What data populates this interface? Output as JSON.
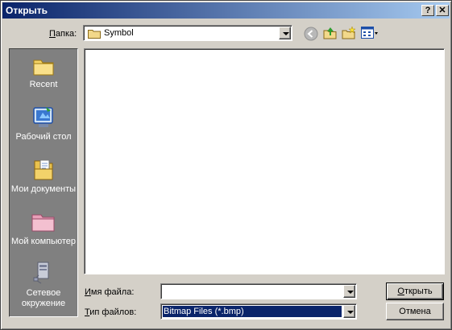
{
  "window": {
    "title": "Открыть",
    "help_glyph": "?",
    "close_glyph": "✕"
  },
  "lookin": {
    "label_ul": "П",
    "label_rest": "апка:",
    "value": "Symbol"
  },
  "toolbar": {
    "back_icon": "back-icon",
    "up_icon": "up-folder-icon",
    "new_folder_icon": "new-folder-icon",
    "views_icon": "views-menu-icon"
  },
  "places": [
    {
      "label": "Recent",
      "icon": "recent-folder-icon"
    },
    {
      "label": "Рабочий стол",
      "icon": "desktop-icon"
    },
    {
      "label": "Мои документы",
      "icon": "my-documents-icon"
    },
    {
      "label": "Мой компьютер",
      "icon": "my-computer-icon"
    },
    {
      "label": "Сетевое окружение",
      "icon": "network-icon"
    }
  ],
  "filename": {
    "label_ul": "И",
    "label_rest": "мя файла:",
    "value": ""
  },
  "filetype": {
    "label_ul": "Т",
    "label_rest": "ип файлов:",
    "value": "Bitmap Files (*.bmp)"
  },
  "buttons": {
    "open_ul": "О",
    "open_rest": "ткрыть",
    "cancel": "Отмена"
  },
  "colors": {
    "title_start": "#0a246a",
    "title_end": "#a6caf0",
    "face": "#d4d0c8",
    "selection": "#0a246a"
  }
}
